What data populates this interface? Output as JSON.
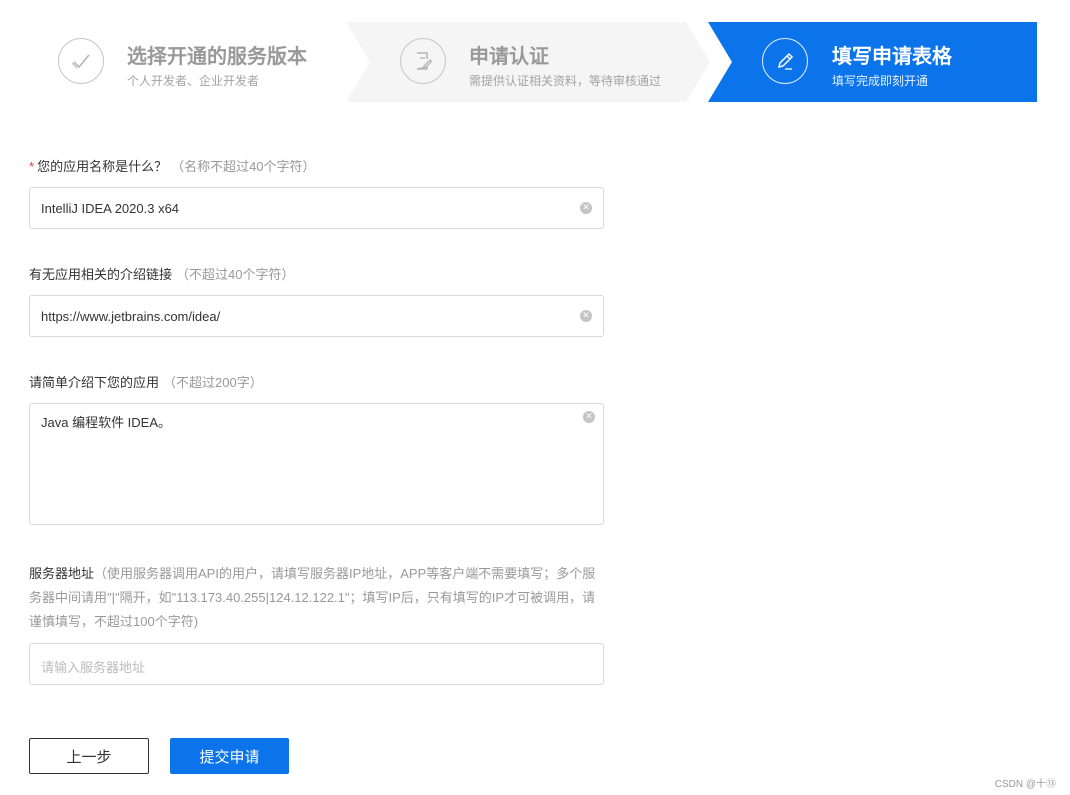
{
  "steps": [
    {
      "title": "选择开通的服务版本",
      "desc": "个人开发者、企业开发者",
      "icon": "check-circle-icon",
      "state": "done"
    },
    {
      "title": "申请认证",
      "desc": "需提供认证相关资料，等待审核通过",
      "icon": "document-edit-icon",
      "state": "done"
    },
    {
      "title": "填写申请表格",
      "desc": "填写完成即刻开通",
      "icon": "pencil-icon",
      "state": "active"
    }
  ],
  "form": {
    "app_name": {
      "required_mark": "*",
      "label": "您的应用名称是什么？",
      "hint": "（名称不超过40个字符）",
      "value": "IntelliJ IDEA 2020.3 x64"
    },
    "intro_link": {
      "label": "有无应用相关的介绍链接",
      "hint": "（不超过40个字符）",
      "value": "https://www.jetbrains.com/idea/"
    },
    "description": {
      "label": "请简单介绍下您的应用",
      "hint": "（不超过200字）",
      "value": "Java 编程软件 IDEA。"
    },
    "server_address": {
      "label": "服务器地址",
      "hint": "（使用服务器调用API的用户，请填写服务器IP地址，APP等客户端不需要填写；多个服务器中间请用\"|\"隔开，如\"113.173.40.255|124.12.122.1\"；填写IP后，只有填写的IP才可被调用，请谨慎填写，不超过100个字符)",
      "placeholder": "请输入服务器地址",
      "value": ""
    }
  },
  "buttons": {
    "prev": "上一步",
    "submit": "提交申请"
  },
  "watermark": "CSDN @十⑬",
  "colors": {
    "accent": "#0b74ea",
    "inactive_step_bg": "#f5f5f5",
    "required": "#e4393c"
  }
}
